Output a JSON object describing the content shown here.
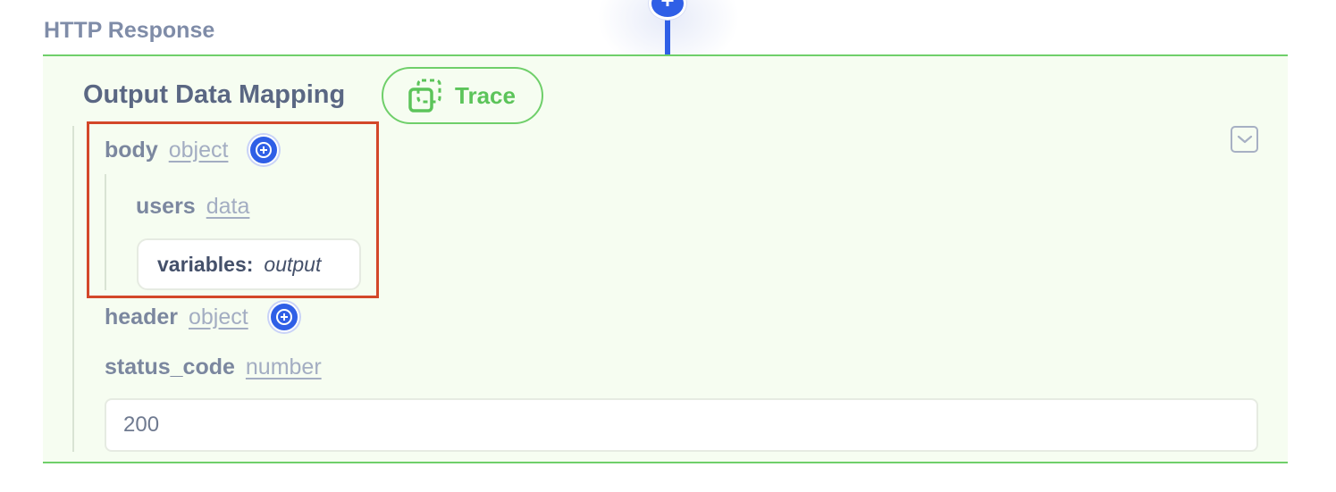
{
  "section": {
    "title": "HTTP Response"
  },
  "connector": {
    "add_label": "+"
  },
  "mapping": {
    "title": "Output Data Mapping",
    "trace_label": "Trace",
    "fields": {
      "body": {
        "name": "body",
        "type": "object"
      },
      "users": {
        "name": "users",
        "type": "data"
      },
      "variable": {
        "key": "variables:",
        "value": "output"
      },
      "header": {
        "name": "header",
        "type": "object"
      },
      "status_code": {
        "name": "status_code",
        "type": "number",
        "value": "200"
      }
    }
  },
  "colors": {
    "accent_blue": "#2f5fe6",
    "panel_green_border": "#6fcf6a",
    "panel_bg": "#f6fdf1",
    "highlight_red": "#d3472a"
  },
  "icons": [
    "plus-circle-icon",
    "trace-icon",
    "chevron-down-icon"
  ]
}
